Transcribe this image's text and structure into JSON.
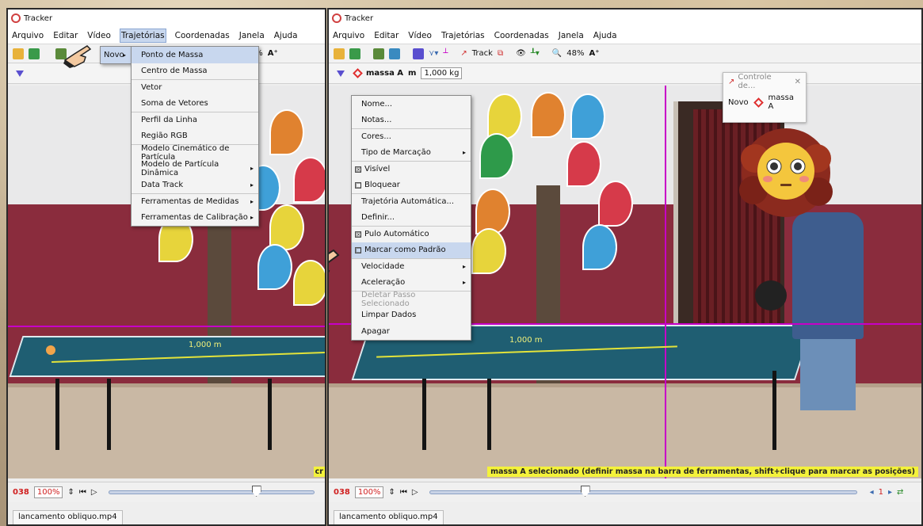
{
  "app_title": "Tracker",
  "menubar": [
    "Arquivo",
    "Editar",
    "Vídeo",
    "Trajetórias",
    "Coordenadas",
    "Janela",
    "Ajuda"
  ],
  "left": {
    "toolbar_zoom": "48%",
    "novo_label": "Novo",
    "trajetorias_submenu": [
      {
        "label": "Ponto de Massa",
        "highlight": true
      },
      {
        "label": "Centro de Massa"
      },
      {
        "label": "Vetor",
        "sep": true
      },
      {
        "label": "Soma de Vetores"
      },
      {
        "label": "Perfil da Linha",
        "sep": true
      },
      {
        "label": "Região RGB"
      },
      {
        "label": "Modelo Cinemático de Partícula",
        "sep": true
      },
      {
        "label": "Modelo de Partícula Dinâmica",
        "arrow": true
      },
      {
        "label": "Data Track",
        "arrow": true
      },
      {
        "label": "Ferramentas de Medidas",
        "arrow": true,
        "sep": true
      },
      {
        "label": "Ferramentas de Calibração",
        "arrow": true
      }
    ],
    "scale_label": "1,000 m",
    "frame_number": "038",
    "zoom": "100%",
    "file_tab": "lancamento obliquo.mp4",
    "status_fragment": "cr"
  },
  "right": {
    "toolbar_track": "Track",
    "toolbar_zoom": "48%",
    "track_name": "massa A",
    "mass_label": "m",
    "mass_value": "1,000 kg",
    "context_menu": [
      {
        "label": "Nome..."
      },
      {
        "label": "Notas..."
      },
      {
        "label": "Cores...",
        "sep": true
      },
      {
        "label": "Tipo de Marcação",
        "arrow": true
      },
      {
        "label": "Visível",
        "check": "☒",
        "sep": true
      },
      {
        "label": "Bloquear",
        "check": "☐"
      },
      {
        "label": "Trajetória Automática...",
        "sep": true
      },
      {
        "label": "Definir..."
      },
      {
        "label": "Pulo Automático",
        "check": "☒",
        "sep": true
      },
      {
        "label": "Marcar como Padrão",
        "check": "☐",
        "highlight": true
      },
      {
        "label": "Velocidade",
        "arrow": true,
        "sep": true
      },
      {
        "label": "Aceleração",
        "arrow": true
      },
      {
        "label": "Deletar Passo Selecionado",
        "disabled": true,
        "sep": true
      },
      {
        "label": "Limpar Dados"
      },
      {
        "label": "Apagar"
      }
    ],
    "control_title": "Controle de...",
    "control_novo": "Novo",
    "control_track": "massa A",
    "scale_label": "1,000 m",
    "status_message": "massa A selecionado (definir massa na barra de ferramentas, shift+clique para marcar as posições)",
    "frame_number": "038",
    "zoom": "100%",
    "file_tab": "lancamento obliquo.mp4",
    "step_value": "1"
  }
}
